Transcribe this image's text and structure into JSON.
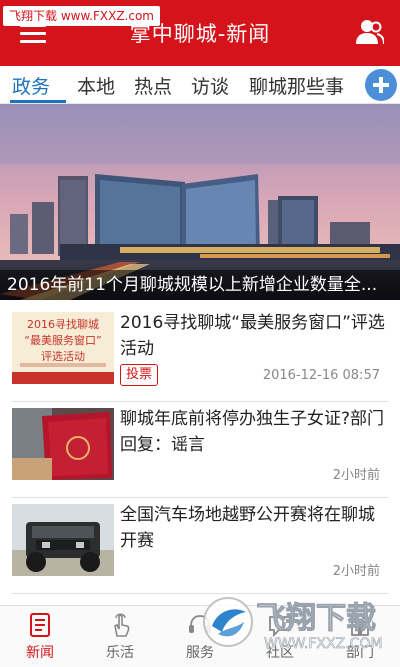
{
  "watermark": "飞翔下载 www.FXXZ.com",
  "header": {
    "title": "掌中聊城-新闻"
  },
  "tabs": [
    {
      "label": "政务",
      "active": true
    },
    {
      "label": "本地"
    },
    {
      "label": "热点"
    },
    {
      "label": "访谈"
    },
    {
      "label": "聊城那些事"
    }
  ],
  "hero": {
    "caption": "2016年前11个月聊城规模以上新增企业数量全..."
  },
  "news": [
    {
      "title": "2016寻找聊城“最美服务窗口”评选活动",
      "badge": "投票",
      "time": "2016-12-16 08:57",
      "thumb_text": {
        "line1": "2016寻找聊城",
        "line2": "“最美服务窗口”",
        "line3": "评选活动"
      }
    },
    {
      "title": "聊城年底前将停办独生子女证?部门回复：谣言",
      "time": "2小时前"
    },
    {
      "title": "全国汽车场地越野公开赛将在聊城开赛",
      "time": "2小时前"
    }
  ],
  "bottom_nav": [
    {
      "label": "新闻",
      "icon": "news-icon",
      "active": true
    },
    {
      "label": "乐活",
      "icon": "hand-tap-icon"
    },
    {
      "label": "服务",
      "icon": "service-icon"
    },
    {
      "label": "社区",
      "icon": "community-icon"
    },
    {
      "label": "部门",
      "icon": "department-icon"
    }
  ],
  "brand_watermark": {
    "text": "飞翔下载",
    "url": "WWW.FXXZ.COM"
  },
  "colors": {
    "header_red": "#d4141a",
    "tab_blue": "#1e73be"
  }
}
